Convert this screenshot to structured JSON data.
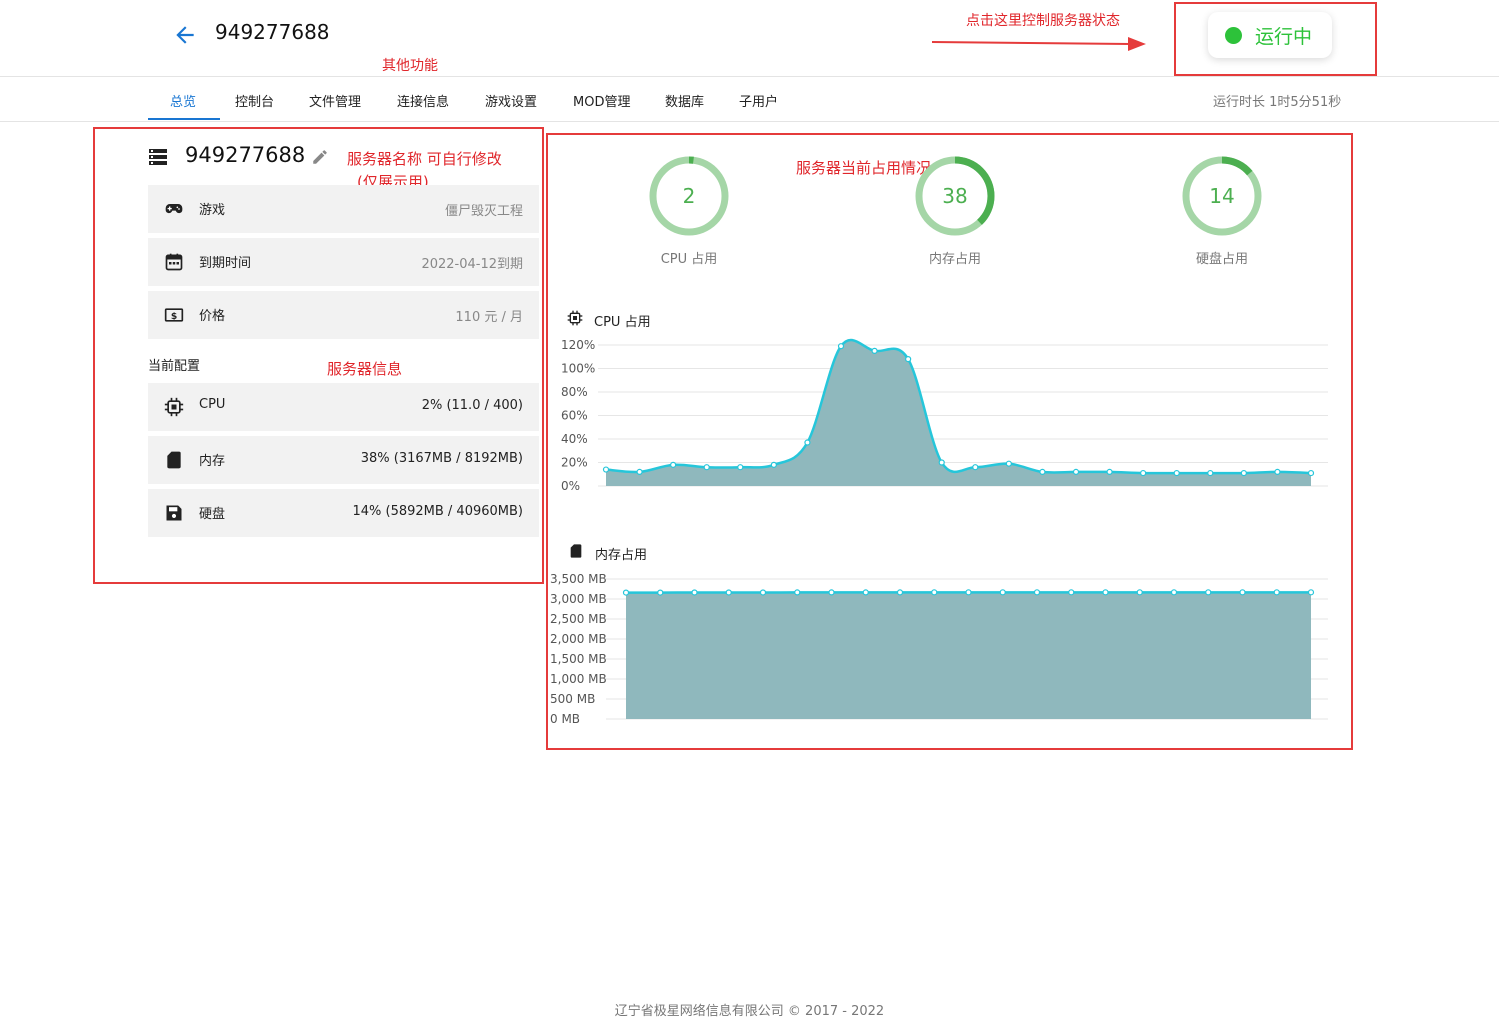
{
  "header": {
    "title": "949277688",
    "status_label": "运行中",
    "status_color": "#2dc23a",
    "annotation_control": "点击这里控制服务器状态",
    "annotation_other": "其他功能"
  },
  "tabs": [
    {
      "label": "总览",
      "active": true
    },
    {
      "label": "控制台"
    },
    {
      "label": "文件管理"
    },
    {
      "label": "连接信息"
    },
    {
      "label": "游戏设置"
    },
    {
      "label": "MOD管理"
    },
    {
      "label": "数据库"
    },
    {
      "label": "子用户"
    }
  ],
  "uptime": "运行时长 1时5分51秒",
  "server": {
    "name": "949277688",
    "annotation_name": "服务器名称 可自行修改",
    "annotation_name_2": "(仅展示用)",
    "rows": [
      {
        "icon": "gamepad-icon",
        "label": "游戏",
        "value": "僵尸毁灭工程"
      },
      {
        "icon": "calendar-icon",
        "label": "到期时间",
        "value": "2022-04-12到期"
      },
      {
        "icon": "dollar-icon",
        "label": "价格",
        "value": "110 元 / 月"
      }
    ],
    "config_title": "当前配置",
    "annotation_info": "服务器信息",
    "config": [
      {
        "icon": "chip-icon",
        "label": "CPU",
        "value": "2% (11.0 / 400)"
      },
      {
        "icon": "memory-card-icon",
        "label": "内存",
        "value": "38% (3167MB / 8192MB)"
      },
      {
        "icon": "floppy-disk-icon",
        "label": "硬盘",
        "value": "14% (5892MB / 40960MB)"
      }
    ]
  },
  "usage": {
    "annotation": "服务器当前占用情况",
    "rings": [
      {
        "value": 2,
        "label": "CPU 占用"
      },
      {
        "value": 38,
        "label": "内存占用"
      },
      {
        "value": 14,
        "label": "硬盘占用"
      }
    ]
  },
  "chart_data": [
    {
      "type": "area",
      "title": "CPU 占用",
      "ylim": [
        0,
        120
      ],
      "yticks": [
        "0%",
        "20%",
        "40%",
        "60%",
        "80%",
        "100%",
        "120%"
      ],
      "values": [
        14,
        12,
        18,
        16,
        16,
        18,
        37,
        119,
        115,
        108,
        20,
        16,
        19,
        12,
        12,
        12,
        11,
        11,
        11,
        11,
        12,
        11
      ],
      "color": "#26c6da",
      "fill": "#8fb8bd"
    },
    {
      "type": "area",
      "title": "内存占用",
      "ylim": [
        0,
        3500
      ],
      "yticks": [
        "0 MB",
        "500 MB",
        "1,000 MB",
        "1,500 MB",
        "2,000 MB",
        "2,500 MB",
        "3,000 MB",
        "3,500 MB"
      ],
      "values": [
        3160,
        3160,
        3163,
        3163,
        3163,
        3165,
        3165,
        3165,
        3165,
        3167,
        3167,
        3167,
        3167,
        3167,
        3167,
        3167,
        3167,
        3167,
        3167,
        3167,
        3167
      ],
      "color": "#26c6da",
      "fill": "#8fb8bd"
    }
  ],
  "footer": "辽宁省极星网络信息有限公司 © 2017 - 2022"
}
